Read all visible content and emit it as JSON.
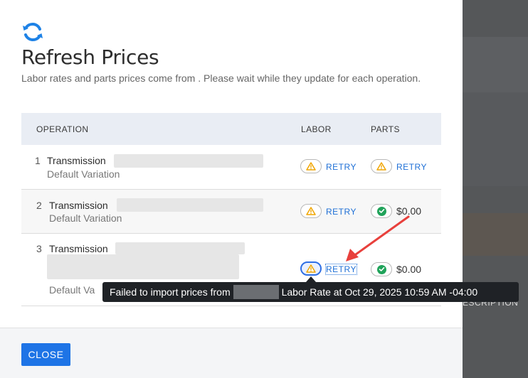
{
  "dialog": {
    "title": "Refresh Prices",
    "subtitle": "Labor rates and parts prices come from . Please wait while they update for each operation.",
    "icon": "refresh-icon"
  },
  "table": {
    "headers": {
      "operation": "OPERATION",
      "labor": "LABOR",
      "parts": "PARTS"
    },
    "rows": [
      {
        "num": "1",
        "name": "Transmission",
        "variation": "Default Variation",
        "labor_status": "warning",
        "labor_action": "RETRY",
        "parts_status": "warning",
        "parts_action": "RETRY"
      },
      {
        "num": "2",
        "name": "Transmission",
        "variation": "Default Variation",
        "labor_status": "warning",
        "labor_action": "RETRY",
        "parts_status": "ok",
        "parts_price": "$0.00"
      },
      {
        "num": "3",
        "name": "Transmission",
        "variation": "Default Va",
        "labor_status": "warning",
        "labor_action": "RETRY",
        "parts_status": "ok",
        "parts_price": "$0.00"
      }
    ]
  },
  "tooltip": {
    "prefix": "Failed to import prices from",
    "suffix": "Labor Rate at Oct 29, 2025 10:59 AM -04:00"
  },
  "footer": {
    "close_label": "CLOSE"
  },
  "backdrop": {
    "partial_text": "ESCRIPTION"
  },
  "colors": {
    "accent": "#1e74e6",
    "warning": "#f0a500",
    "success": "#20a35a",
    "annotation": "#e8403c"
  }
}
